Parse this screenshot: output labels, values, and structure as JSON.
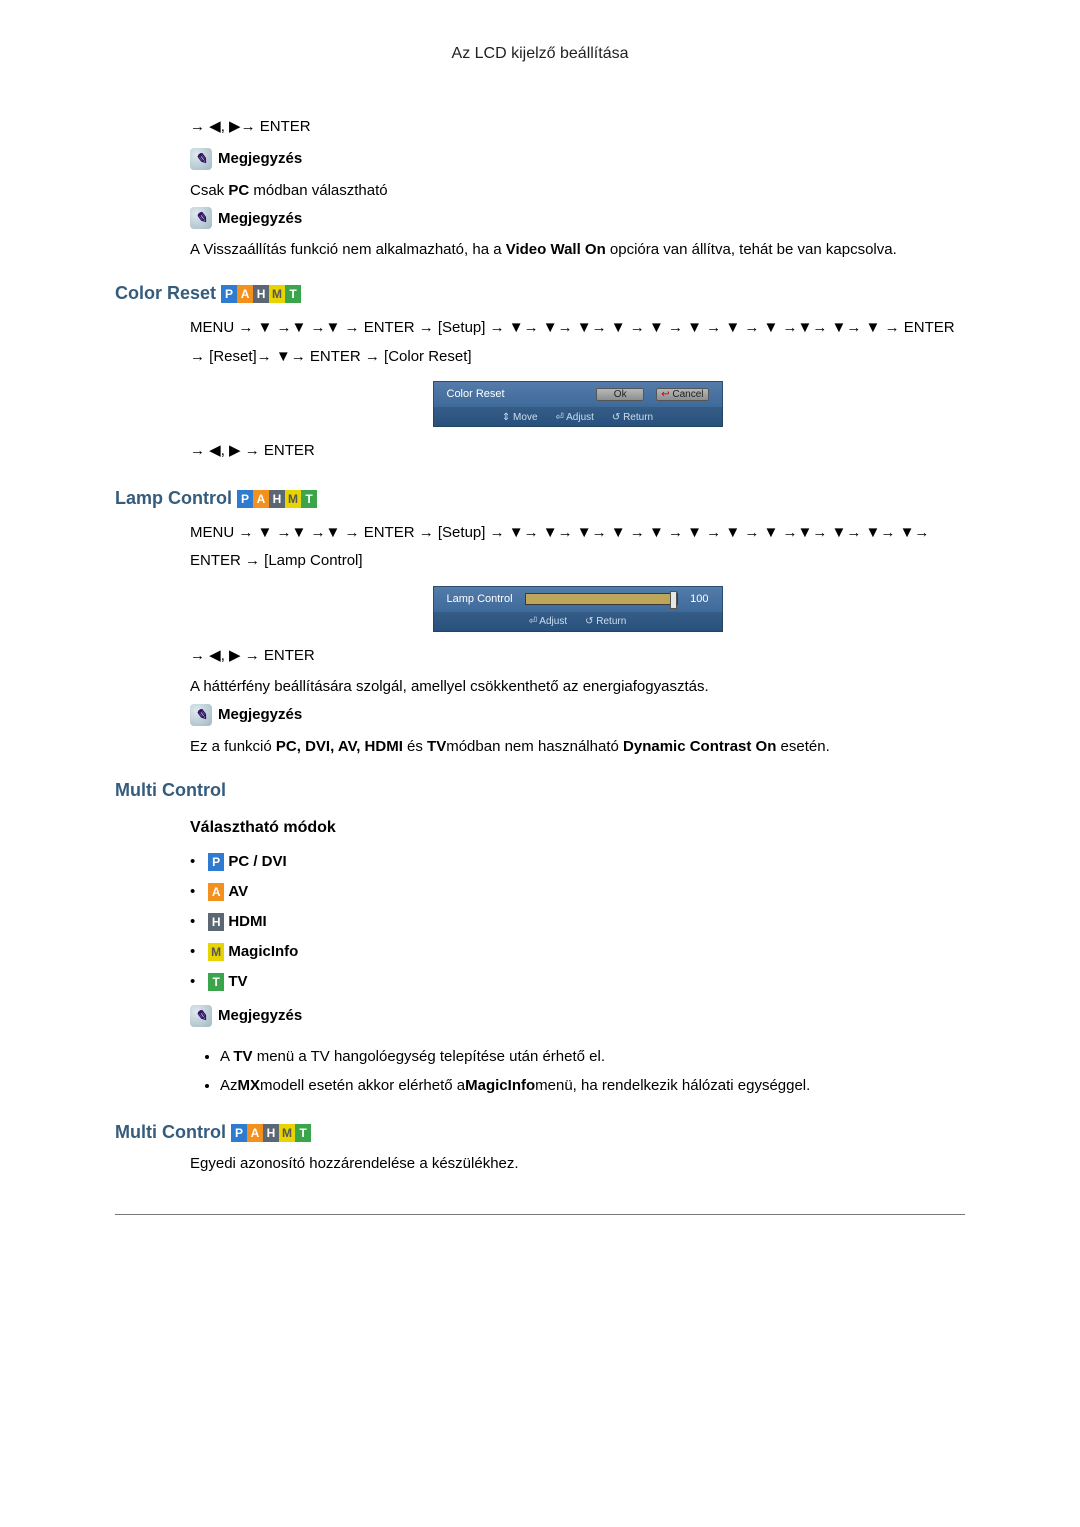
{
  "header": {
    "title": "Az LCD kijelző beállítása"
  },
  "notes": {
    "label": "Megjegyzés"
  },
  "note_icon_glyph": "✎",
  "modes": {
    "P": "P",
    "A": "A",
    "H": "H",
    "M": "M",
    "T": "T"
  },
  "section_color_reset": {
    "title": "Color Reset",
    "preceding_enter": "→ ◀, ▶→ ENTER",
    "note1_text_prefix": "Csak ",
    "note1_pc": "PC",
    "note1_text_suffix": " módban választható",
    "note2_text_a": "A Visszaállítás funkció nem alkalmazható, ha a ",
    "note2_video_wall": "Video Wall On",
    "note2_text_b": " opcióra van állítva, tehát be van kapcsolva.",
    "nav": "MENU → ▼ →▼ →▼ → ENTER → [Setup] → ▼→ ▼→ ▼→ ▼ → ▼ → ▼ → ▼ → ▼ →▼→ ▼→ ▼ → ENTER → [Reset]→ ▼→ ENTER → [Color Reset]",
    "osd": {
      "label": "Color Reset",
      "ok": "Ok",
      "cancel": "Cancel",
      "footer_move": "⇕ Move",
      "footer_adjust": "⏎ Adjust",
      "footer_return": "↺ Return"
    },
    "post_enter": "→ ◀, ▶ → ENTER"
  },
  "section_lamp": {
    "title": "Lamp Control",
    "nav": "MENU → ▼ →▼ →▼ → ENTER → [Setup] → ▼→ ▼→ ▼→ ▼ → ▼ → ▼ → ▼ → ▼ →▼→ ▼→ ▼→ ▼→ ENTER → [Lamp Control]",
    "osd": {
      "label": "Lamp Control",
      "value": "100",
      "footer_adjust": "⏎ Adjust",
      "footer_return": "↺ Return"
    },
    "post_enter": "→ ◀, ▶ → ENTER",
    "body": "A háttérfény beállítására szolgál, amellyel csökkenthető az energiafogyasztás.",
    "note_a": "Ez a funkció ",
    "note_modes": "PC, DVI, AV, HDMI",
    "note_mid": " és ",
    "note_tv": "TV",
    "note_b": "módban nem használható ",
    "note_dyn": "Dynamic Contrast On",
    "note_c": " esetén."
  },
  "section_multi": {
    "title": "Multi Control",
    "subhead": "Választható módok",
    "items": [
      {
        "badge": "P",
        "label": "PC / DVI"
      },
      {
        "badge": "A",
        "label": "AV"
      },
      {
        "badge": "H",
        "label": "HDMI"
      },
      {
        "badge": "M",
        "label": "MagicInfo"
      },
      {
        "badge": "T",
        "label": "TV"
      }
    ],
    "bullets": [
      {
        "pre": "A ",
        "b1": "TV",
        "mid": " menü a TV hangolóegység telepítése után érhető el."
      },
      {
        "pre": "Az",
        "b1": "MX",
        "mid": "modell esetén akkor elérhető a",
        "b2": "MagicInfo",
        "post": "menü, ha rendelkezik hálózati egységgel."
      }
    ],
    "second_title": "Multi Control",
    "second_body": "Egyedi azonosító hozzárendelése a készülékhez."
  }
}
